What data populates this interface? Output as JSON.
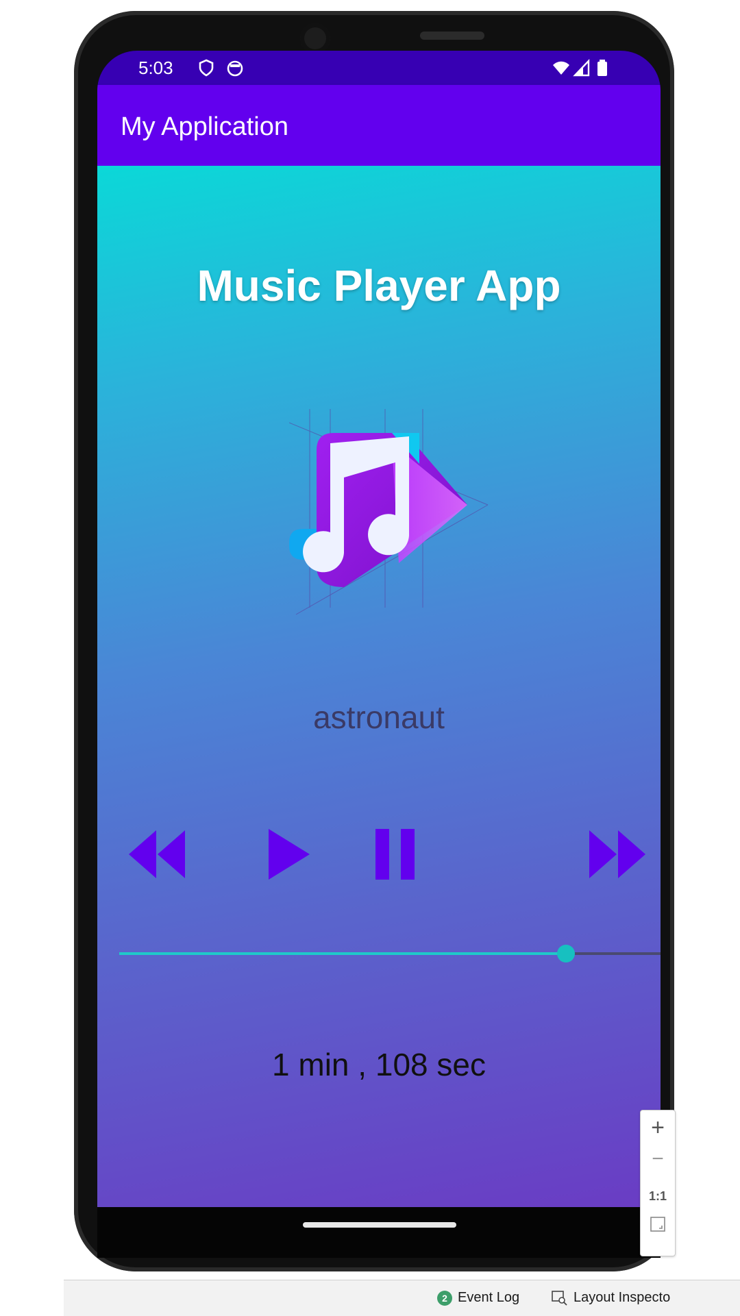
{
  "status_bar": {
    "time": "5:03"
  },
  "app_bar": {
    "title": "My Application"
  },
  "main": {
    "title": "Music Player App",
    "track_name": "astronaut",
    "progress_fraction": 0.825,
    "duration_text": "1 min , 108 sec"
  },
  "controls": {
    "icons": [
      "rewind-icon",
      "play-icon",
      "pause-icon",
      "fast-forward-icon"
    ],
    "color": "#6200ee"
  },
  "colors": {
    "status_bar": "#3700b3",
    "app_bar": "#6200ee",
    "seek_active": "#1fc9c9"
  },
  "zoom_controls": {
    "plus": "+",
    "minus": "−",
    "reset": "1:1"
  },
  "ide_bottom_bar": {
    "event_log_badge": "2",
    "event_log_label": "Event Log",
    "layout_inspector_label": "Layout Inspecto"
  }
}
